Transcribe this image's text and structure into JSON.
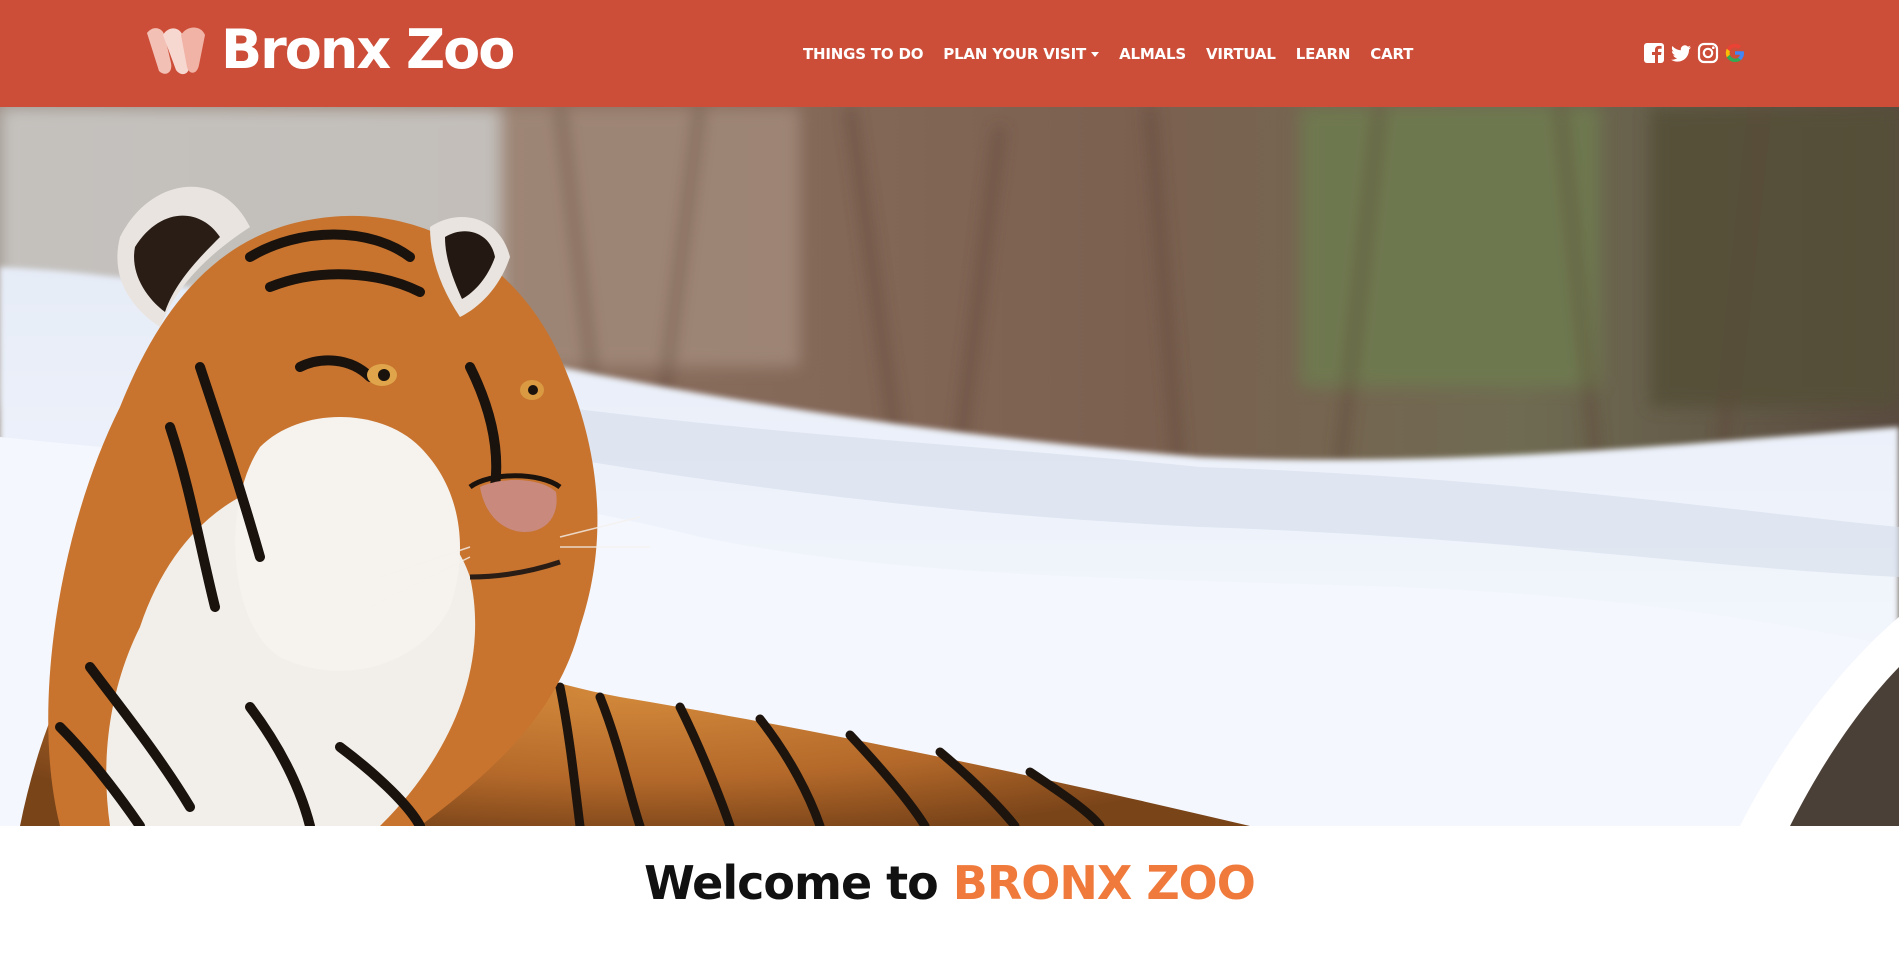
{
  "brand": {
    "name": "Bronx Zoo",
    "color": "#cc4d38",
    "accent": "#f07a3c"
  },
  "nav": {
    "items": [
      {
        "label": "THINGS TO DO"
      },
      {
        "label": "PLAN YOUR VISIT",
        "has_dropdown": true
      },
      {
        "label": "ALMALS"
      },
      {
        "label": "VIRTUAL"
      },
      {
        "label": "LEARN"
      },
      {
        "label": "CART"
      }
    ]
  },
  "social": {
    "icons": [
      "facebook-icon",
      "twitter-icon",
      "instagram-icon",
      "google-icon"
    ]
  },
  "hero": {
    "subject": "tiger-in-snow-photo"
  },
  "welcome": {
    "prefix": "Welcome to",
    "highlight": "BRONX ZOO"
  }
}
